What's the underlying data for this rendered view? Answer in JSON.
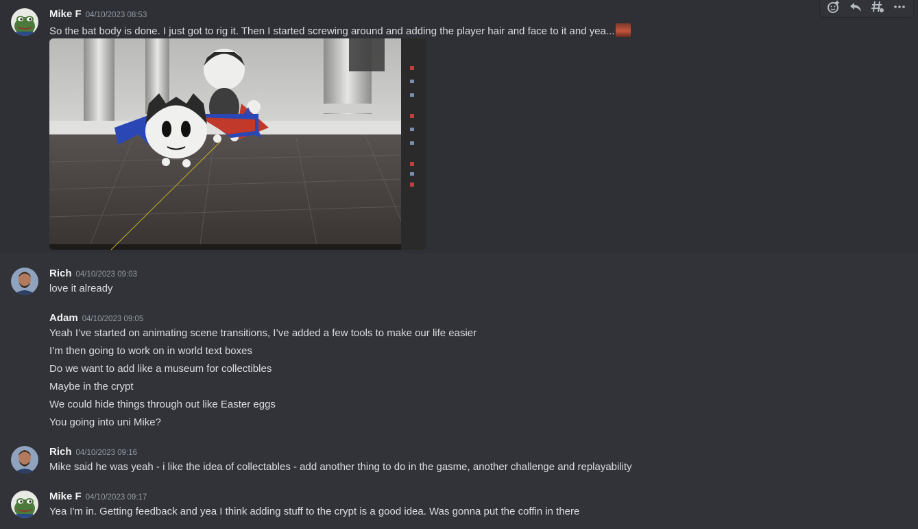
{
  "toolbar": {
    "actions": [
      {
        "icon": "add-reaction-icon"
      },
      {
        "icon": "reply-icon"
      },
      {
        "icon": "create-thread-icon"
      },
      {
        "icon": "more-options-icon"
      }
    ]
  },
  "messages": [
    {
      "author": "Mike F",
      "timestamp": "04/10/2023 08:53",
      "avatar": "pepe-frog-avatar",
      "lines": [
        "So the bat body is done. I just got to rig it. Then I started screwing around and adding the player hair and face to it and yea..."
      ],
      "inline_emoji": "custom-emoji",
      "attachment": {
        "type": "image",
        "icon": "3d-render-photo"
      }
    },
    {
      "author": "Rich",
      "timestamp": "04/10/2023 09:03",
      "avatar": "rich-photo-avatar",
      "lines": [
        "love it already"
      ]
    },
    {
      "author": "Adam",
      "timestamp": "04/10/2023 09:05",
      "lines": [
        "Yeah I’ve started on animating scene transitions, I’ve added a few tools to make our life easier",
        "I’m then going to work on in world text boxes",
        "Do we want to add like a museum for collectibles",
        "Maybe in the crypt",
        "We could hide things through out like Easter eggs",
        "You going into uni Mike?"
      ]
    },
    {
      "author": "Rich",
      "timestamp": "04/10/2023 09:16",
      "avatar": "rich-photo-avatar",
      "lines": [
        "Mike said he was yeah - i like the idea of collectables - add another thing to do in the gasme, another challenge and replayability"
      ]
    },
    {
      "author": "Mike F",
      "timestamp": "04/10/2023 09:17",
      "avatar": "pepe-frog-avatar",
      "lines": [
        "Yea I'm in. Getting feedback and yea I think adding stuff to the crypt is a good idea. Was gonna put the coffin in there"
      ]
    }
  ],
  "colors": {
    "background": "#313338",
    "hover_background": "#2e3035",
    "author": "#f2f3f5",
    "text": "#dbdee1",
    "timestamp": "#949ba4"
  }
}
